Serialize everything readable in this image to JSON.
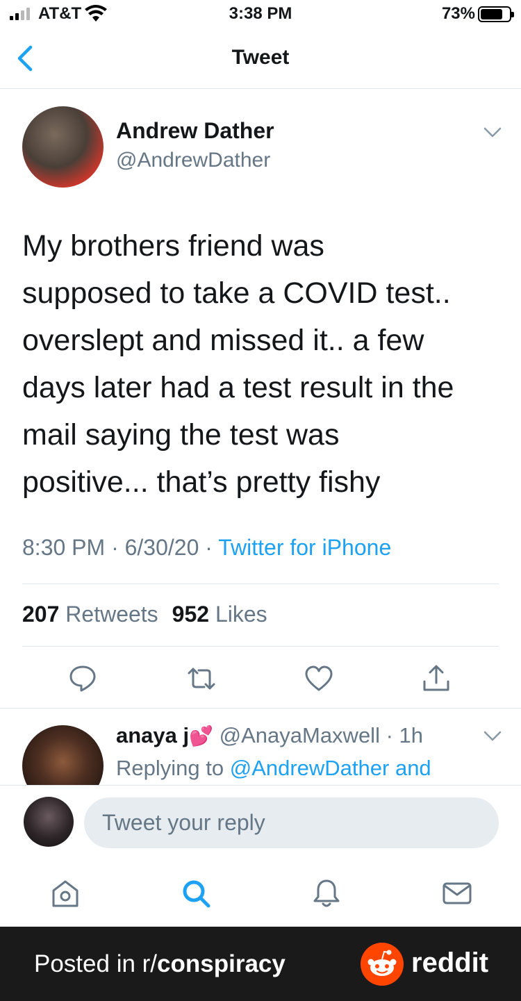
{
  "status_bar": {
    "carrier": "AT&T",
    "time": "3:38 PM",
    "battery": "73%",
    "battery_level": 0.73,
    "signal_bars_filled": 2
  },
  "nav": {
    "title": "Tweet"
  },
  "tweet": {
    "author_name": "Andrew Dather",
    "author_handle": "@AndrewDather",
    "text_lines": [
      "My brothers friend was",
      "supposed to take a COVID test..",
      "overslept and missed it.. a few",
      "days later had a test result in the",
      "mail saying the test was",
      "positive... that’s pretty fishy"
    ],
    "time": "8:30 PM",
    "date": "6/30/20",
    "separator": " · ",
    "source": "Twitter for iPhone",
    "retweets_count": "207",
    "retweets_label": "Retweets",
    "likes_count": "952",
    "likes_label": "Likes"
  },
  "reply_preview": {
    "name": "anaya j",
    "emoji": "💕",
    "handle": "@AnayaMaxwell",
    "dot": " · ",
    "age": "1h",
    "replying_prefix": "Replying to ",
    "replying_to": "@AndrewDather and"
  },
  "composer": {
    "placeholder": "Tweet your reply"
  },
  "footer": {
    "posted_prefix": "Posted in r/",
    "subreddit": "conspiracy",
    "brand": "reddit"
  },
  "colors": {
    "accent": "#1da1f2",
    "secondary_text": "#657786",
    "footer_bg": "#1a1a1b",
    "reddit_orange": "#ff4500"
  },
  "icons": {
    "back": "chevron-left-icon",
    "more": "chevron-down-icon",
    "reply": "comment-icon",
    "retweet": "retweet-icon",
    "like": "heart-icon",
    "share": "share-icon",
    "home": "home-icon",
    "search": "search-icon",
    "notifications": "bell-icon",
    "messages": "envelope-icon"
  }
}
